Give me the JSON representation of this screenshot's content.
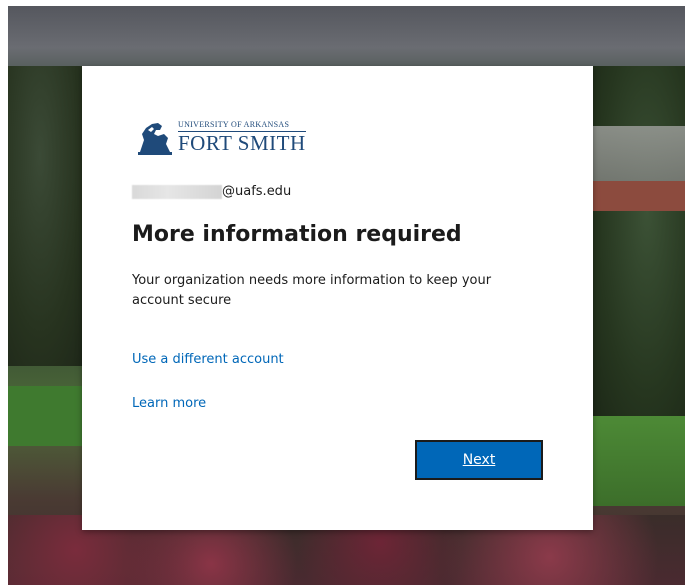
{
  "logo": {
    "line1": "UNIVERSITY of ARKANSAS",
    "line2": "FORT SMITH"
  },
  "identity": {
    "email_suffix": "@uafs.edu"
  },
  "dialog": {
    "title": "More information required",
    "description": "Your organization needs more information to keep your account secure",
    "use_different_account": "Use a different account",
    "learn_more": "Learn more",
    "next_label": "Next"
  },
  "colors": {
    "accent": "#0067b8",
    "text": "#1b1b1b",
    "brand": "#1f4a7a"
  },
  "icons": {
    "logo_mark": "lion-crest-icon"
  }
}
